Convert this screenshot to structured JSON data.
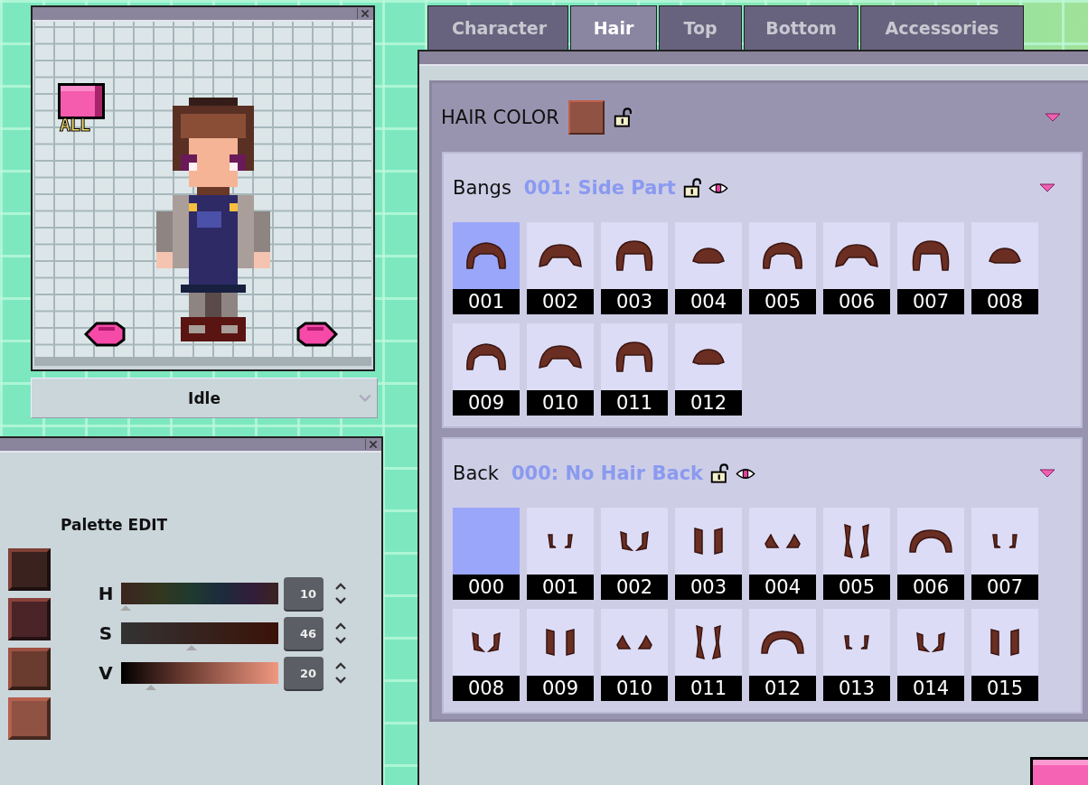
{
  "preview": {
    "badge": "ALL",
    "animation": "Idle"
  },
  "palette": {
    "title": "Palette EDIT",
    "swatches": [
      {
        "color": "#3a221f"
      },
      {
        "color": "#4a2427"
      },
      {
        "color": "#6a3b2f"
      },
      {
        "color": "#8f5243"
      }
    ],
    "sliders": [
      {
        "label": "H",
        "level": 0.03,
        "value": "10"
      },
      {
        "label": "S",
        "level": 0.45,
        "value": "46"
      },
      {
        "label": "V",
        "level": 0.19,
        "value": "20"
      }
    ]
  },
  "tabs": [
    {
      "label": "Character",
      "selected": false
    },
    {
      "label": "Hair",
      "selected": true
    },
    {
      "label": "Top",
      "selected": false
    },
    {
      "label": "Bottom",
      "selected": false
    },
    {
      "label": "Accessories",
      "selected": false
    }
  ],
  "hair_color": {
    "label": "HAIR COLOR",
    "color": "#8f5243",
    "locked": false
  },
  "sections": [
    {
      "label": "Bangs",
      "current": "001: Side Part",
      "locked": false,
      "items": [
        {
          "number": "001",
          "selected": true
        },
        {
          "number": "002",
          "selected": false
        },
        {
          "number": "003",
          "selected": false
        },
        {
          "number": "004",
          "selected": false
        },
        {
          "number": "005",
          "selected": false
        },
        {
          "number": "006",
          "selected": false
        },
        {
          "number": "007",
          "selected": false
        },
        {
          "number": "008",
          "selected": false
        },
        {
          "number": "009",
          "selected": false
        },
        {
          "number": "010",
          "selected": false
        },
        {
          "number": "011",
          "selected": false
        },
        {
          "number": "012",
          "selected": false
        }
      ]
    },
    {
      "label": "Back",
      "current": "000: No Hair Back",
      "locked": false,
      "items": [
        {
          "number": "000",
          "selected": true
        },
        {
          "number": "001",
          "selected": false
        },
        {
          "number": "002",
          "selected": false
        },
        {
          "number": "003",
          "selected": false
        },
        {
          "number": "004",
          "selected": false
        },
        {
          "number": "005",
          "selected": false
        },
        {
          "number": "006",
          "selected": false
        },
        {
          "number": "007",
          "selected": false
        },
        {
          "number": "008",
          "selected": false
        },
        {
          "number": "009",
          "selected": false
        },
        {
          "number": "010",
          "selected": false
        },
        {
          "number": "011",
          "selected": false
        },
        {
          "number": "012",
          "selected": false
        },
        {
          "number": "013",
          "selected": false
        },
        {
          "number": "014",
          "selected": false
        },
        {
          "number": "015",
          "selected": false
        }
      ]
    }
  ]
}
